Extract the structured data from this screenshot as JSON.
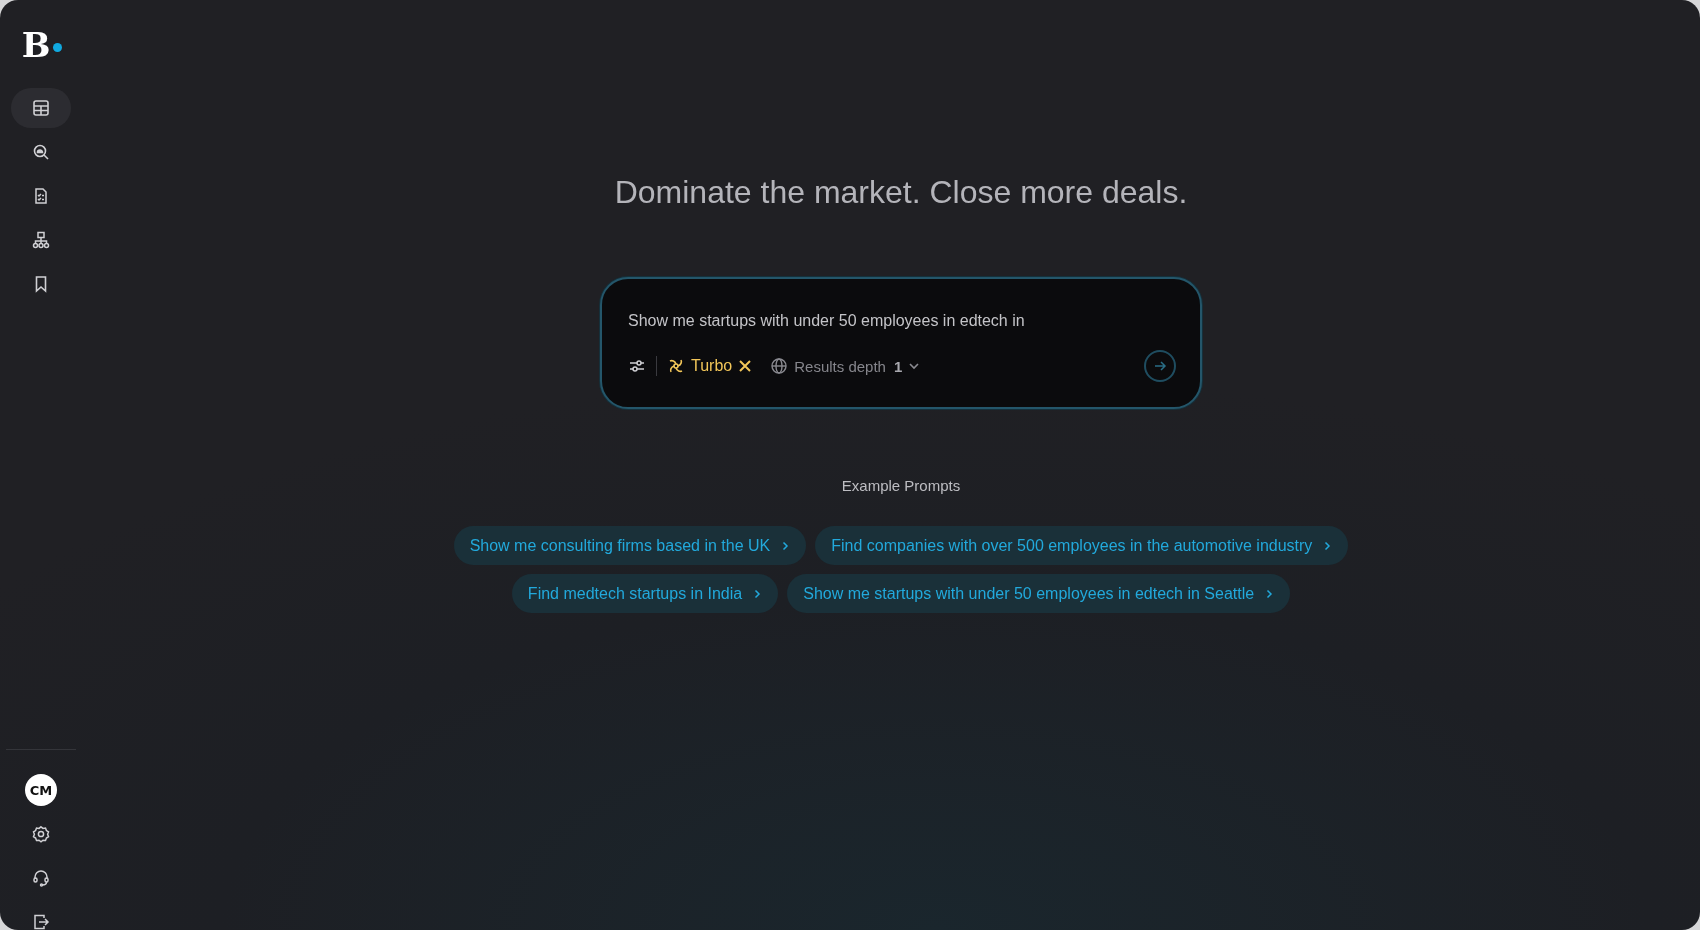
{
  "sidebar": {
    "logo": "B",
    "nav_items": [
      {
        "selected": true
      },
      {
        "selected": false
      },
      {
        "selected": false
      },
      {
        "selected": false
      },
      {
        "selected": false
      }
    ],
    "avatar": "CM"
  },
  "headline": "Dominate the market. Close more deals.",
  "search": {
    "placeholder": "Show me startups with under 50 employees in edtech in",
    "mode": {
      "label": "Turbo",
      "on": true
    },
    "depth": {
      "label": "Results depth",
      "value": "1"
    }
  },
  "examples": {
    "title": "Example Prompts",
    "prompts": [
      "Show me consulting firms based in the UK",
      "Find companies with over 500 employees in the automotive industry",
      "Find medtech startups in India",
      "Show me startups with under 50 employees in edtech in Seattle"
    ]
  }
}
